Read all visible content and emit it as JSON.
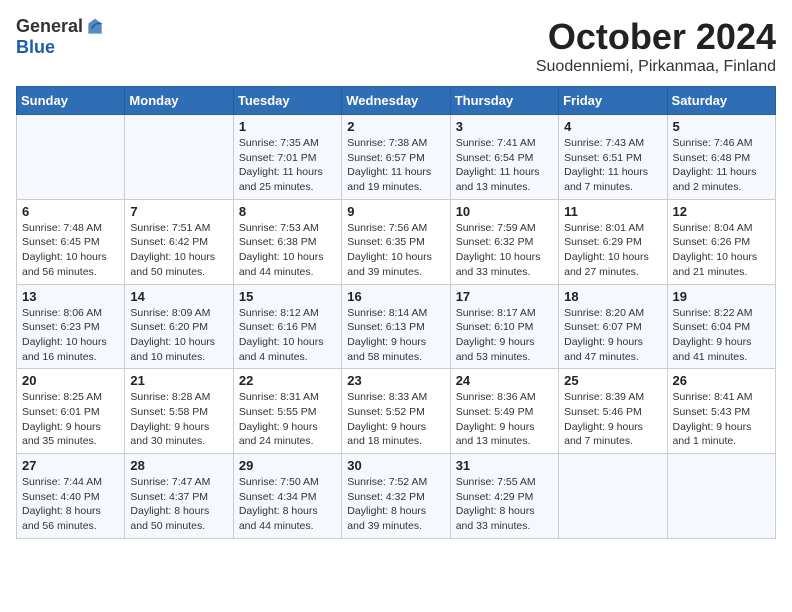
{
  "logo": {
    "general": "General",
    "blue": "Blue"
  },
  "title": {
    "month": "October 2024",
    "location": "Suodenniemi, Pirkanmaa, Finland"
  },
  "weekdays": [
    "Sunday",
    "Monday",
    "Tuesday",
    "Wednesday",
    "Thursday",
    "Friday",
    "Saturday"
  ],
  "weeks": [
    [
      {
        "day": "",
        "info": ""
      },
      {
        "day": "",
        "info": ""
      },
      {
        "day": "1",
        "info": "Sunrise: 7:35 AM\nSunset: 7:01 PM\nDaylight: 11 hours\nand 25 minutes."
      },
      {
        "day": "2",
        "info": "Sunrise: 7:38 AM\nSunset: 6:57 PM\nDaylight: 11 hours\nand 19 minutes."
      },
      {
        "day": "3",
        "info": "Sunrise: 7:41 AM\nSunset: 6:54 PM\nDaylight: 11 hours\nand 13 minutes."
      },
      {
        "day": "4",
        "info": "Sunrise: 7:43 AM\nSunset: 6:51 PM\nDaylight: 11 hours\nand 7 minutes."
      },
      {
        "day": "5",
        "info": "Sunrise: 7:46 AM\nSunset: 6:48 PM\nDaylight: 11 hours\nand 2 minutes."
      }
    ],
    [
      {
        "day": "6",
        "info": "Sunrise: 7:48 AM\nSunset: 6:45 PM\nDaylight: 10 hours\nand 56 minutes."
      },
      {
        "day": "7",
        "info": "Sunrise: 7:51 AM\nSunset: 6:42 PM\nDaylight: 10 hours\nand 50 minutes."
      },
      {
        "day": "8",
        "info": "Sunrise: 7:53 AM\nSunset: 6:38 PM\nDaylight: 10 hours\nand 44 minutes."
      },
      {
        "day": "9",
        "info": "Sunrise: 7:56 AM\nSunset: 6:35 PM\nDaylight: 10 hours\nand 39 minutes."
      },
      {
        "day": "10",
        "info": "Sunrise: 7:59 AM\nSunset: 6:32 PM\nDaylight: 10 hours\nand 33 minutes."
      },
      {
        "day": "11",
        "info": "Sunrise: 8:01 AM\nSunset: 6:29 PM\nDaylight: 10 hours\nand 27 minutes."
      },
      {
        "day": "12",
        "info": "Sunrise: 8:04 AM\nSunset: 6:26 PM\nDaylight: 10 hours\nand 21 minutes."
      }
    ],
    [
      {
        "day": "13",
        "info": "Sunrise: 8:06 AM\nSunset: 6:23 PM\nDaylight: 10 hours\nand 16 minutes."
      },
      {
        "day": "14",
        "info": "Sunrise: 8:09 AM\nSunset: 6:20 PM\nDaylight: 10 hours\nand 10 minutes."
      },
      {
        "day": "15",
        "info": "Sunrise: 8:12 AM\nSunset: 6:16 PM\nDaylight: 10 hours\nand 4 minutes."
      },
      {
        "day": "16",
        "info": "Sunrise: 8:14 AM\nSunset: 6:13 PM\nDaylight: 9 hours\nand 58 minutes."
      },
      {
        "day": "17",
        "info": "Sunrise: 8:17 AM\nSunset: 6:10 PM\nDaylight: 9 hours\nand 53 minutes."
      },
      {
        "day": "18",
        "info": "Sunrise: 8:20 AM\nSunset: 6:07 PM\nDaylight: 9 hours\nand 47 minutes."
      },
      {
        "day": "19",
        "info": "Sunrise: 8:22 AM\nSunset: 6:04 PM\nDaylight: 9 hours\nand 41 minutes."
      }
    ],
    [
      {
        "day": "20",
        "info": "Sunrise: 8:25 AM\nSunset: 6:01 PM\nDaylight: 9 hours\nand 35 minutes."
      },
      {
        "day": "21",
        "info": "Sunrise: 8:28 AM\nSunset: 5:58 PM\nDaylight: 9 hours\nand 30 minutes."
      },
      {
        "day": "22",
        "info": "Sunrise: 8:31 AM\nSunset: 5:55 PM\nDaylight: 9 hours\nand 24 minutes."
      },
      {
        "day": "23",
        "info": "Sunrise: 8:33 AM\nSunset: 5:52 PM\nDaylight: 9 hours\nand 18 minutes."
      },
      {
        "day": "24",
        "info": "Sunrise: 8:36 AM\nSunset: 5:49 PM\nDaylight: 9 hours\nand 13 minutes."
      },
      {
        "day": "25",
        "info": "Sunrise: 8:39 AM\nSunset: 5:46 PM\nDaylight: 9 hours\nand 7 minutes."
      },
      {
        "day": "26",
        "info": "Sunrise: 8:41 AM\nSunset: 5:43 PM\nDaylight: 9 hours\nand 1 minute."
      }
    ],
    [
      {
        "day": "27",
        "info": "Sunrise: 7:44 AM\nSunset: 4:40 PM\nDaylight: 8 hours\nand 56 minutes."
      },
      {
        "day": "28",
        "info": "Sunrise: 7:47 AM\nSunset: 4:37 PM\nDaylight: 8 hours\nand 50 minutes."
      },
      {
        "day": "29",
        "info": "Sunrise: 7:50 AM\nSunset: 4:34 PM\nDaylight: 8 hours\nand 44 minutes."
      },
      {
        "day": "30",
        "info": "Sunrise: 7:52 AM\nSunset: 4:32 PM\nDaylight: 8 hours\nand 39 minutes."
      },
      {
        "day": "31",
        "info": "Sunrise: 7:55 AM\nSunset: 4:29 PM\nDaylight: 8 hours\nand 33 minutes."
      },
      {
        "day": "",
        "info": ""
      },
      {
        "day": "",
        "info": ""
      }
    ]
  ]
}
